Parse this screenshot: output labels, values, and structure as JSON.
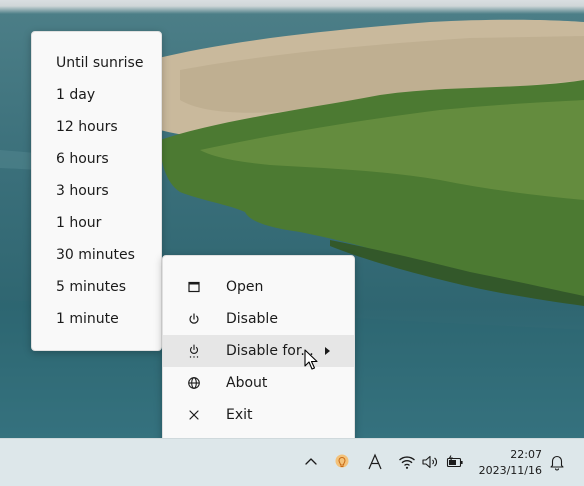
{
  "submenu": {
    "items": [
      {
        "label": "Until sunrise"
      },
      {
        "label": "1 day"
      },
      {
        "label": "12 hours"
      },
      {
        "label": "6 hours"
      },
      {
        "label": "3 hours"
      },
      {
        "label": "1 hour"
      },
      {
        "label": "30 minutes"
      },
      {
        "label": "5 minutes"
      },
      {
        "label": "1 minute"
      }
    ]
  },
  "context_menu": {
    "items": [
      {
        "label": "Open",
        "icon": "window-icon"
      },
      {
        "label": "Disable",
        "icon": "power-icon"
      },
      {
        "label": "Disable for...",
        "icon": "power-timer-icon",
        "has_submenu": true,
        "highlighted": true
      },
      {
        "label": "About",
        "icon": "globe-icon"
      },
      {
        "label": "Exit",
        "icon": "close-icon"
      }
    ]
  },
  "taskbar": {
    "clock_time": "22:07",
    "clock_date": "2023/11/16",
    "tray_icons": [
      "chevron-up-icon",
      "lightbulb-icon",
      "input-method-icon",
      "wifi-icon",
      "speaker-icon",
      "battery-icon",
      "notification-bell-icon"
    ]
  },
  "colors": {
    "menu_bg": "#f9f9f9",
    "highlight_bg": "#e6e6e6",
    "taskbar_bg": "#dde7ea",
    "tray_accent": "#e9963a"
  }
}
